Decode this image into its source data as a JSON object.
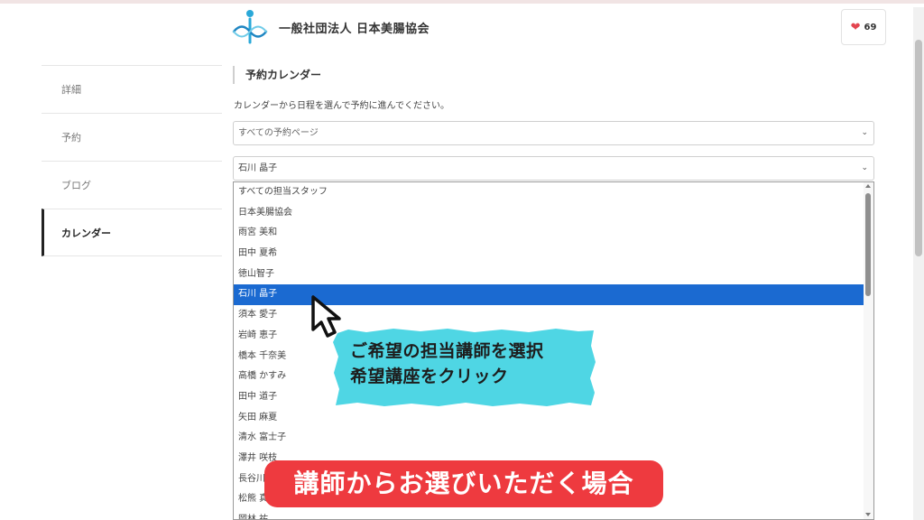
{
  "header": {
    "org_name": "一般社団法人 日本美腸協会",
    "like_count": "69",
    "icons": {
      "logo": "org-logo-icon",
      "like": "heart-icon"
    },
    "colors": {
      "heart": "#e3454f"
    }
  },
  "sidebar": {
    "items": [
      {
        "label": "詳細",
        "active": false
      },
      {
        "label": "予約",
        "active": false
      },
      {
        "label": "ブログ",
        "active": false
      },
      {
        "label": "カレンダー",
        "active": true
      }
    ]
  },
  "main": {
    "section_title": "予約カレンダー",
    "description": "カレンダーから日程を選んで予約に進んでください。",
    "page_select": {
      "value": "すべての予約ページ"
    },
    "staff_select": {
      "value": "石川 晶子"
    }
  },
  "dropdown": {
    "selected_index": 5,
    "selected_color": "#1b6ad1",
    "options": [
      "すべての担当スタッフ",
      "日本美腸協会",
      "雨宮 美和",
      "田中 夏希",
      "徳山智子",
      "石川 晶子",
      "須本 愛子",
      "岩崎 恵子",
      "橋本 千奈美",
      "高橋 かすみ",
      "田中 道子",
      "矢田 麻夏",
      "清水 富士子",
      "澤井 咲枝",
      "長谷川",
      "松熊 真",
      "岡林 祐"
    ]
  },
  "overlay": {
    "callout_lines": [
      "ご希望の担当講師を選択",
      "希望講座をクリック"
    ],
    "callout_color": "#4fd6e4",
    "banner_text": "講師からお選びいただく場合",
    "banner_color": "#ee3a3f",
    "cursor_icon": "pointer-cursor-icon"
  }
}
